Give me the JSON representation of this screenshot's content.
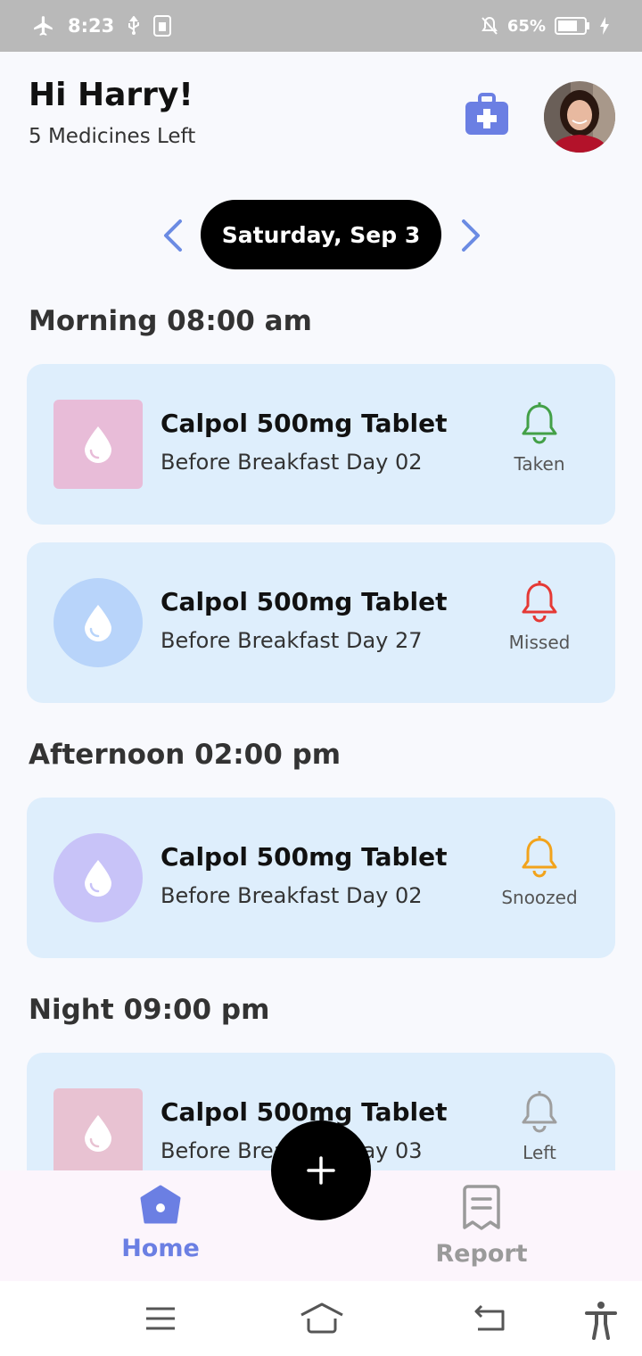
{
  "status_bar": {
    "time": "8:23",
    "battery": "65%",
    "icons": [
      "airplane-icon",
      "usb-icon",
      "sim-icon",
      "mute-icon",
      "battery-icon",
      "charging-icon"
    ]
  },
  "header": {
    "greeting": "Hi Harry!",
    "subtitle": "5 Medicines Left",
    "icons": [
      "medical-kit-icon",
      "avatar"
    ]
  },
  "date_picker": {
    "date": "Saturday, Sep 3"
  },
  "sections": [
    {
      "title": "Morning 08:00 am",
      "items": [
        {
          "name": "Calpol 500mg Tablet",
          "desc": "Before Breakfast Day 02",
          "status": "Taken",
          "status_color": "#43a047",
          "icon_bg": "#e8bcd8",
          "icon_shape": "square"
        },
        {
          "name": "Calpol 500mg Tablet",
          "desc": "Before Breakfast Day 27",
          "status": "Missed",
          "status_color": "#e53935",
          "icon_bg": "#b8d4fa",
          "icon_shape": "circle"
        }
      ]
    },
    {
      "title": "Afternoon 02:00 pm",
      "items": [
        {
          "name": "Calpol 500mg Tablet",
          "desc": "Before Breakfast Day 02",
          "status": "Snoozed",
          "status_color": "#f2a31b",
          "icon_bg": "#c8c3f8",
          "icon_shape": "circle"
        }
      ]
    },
    {
      "title": "Night 09:00 pm",
      "items": [
        {
          "name": "Calpol 500mg Tablet",
          "desc": "Before Breakfast Day 03",
          "status": "Left",
          "status_color": "#9e9e9e",
          "icon_bg": "#e8c2d2",
          "icon_shape": "square"
        }
      ]
    }
  ],
  "bottom_nav": {
    "home": "Home",
    "report": "Report",
    "active_color": "#6b7fe3",
    "inactive_color": "#9a9a9a"
  },
  "fab": {
    "icon": "plus-icon"
  },
  "system_nav": {
    "icons": [
      "menu-icon",
      "home-outline-icon",
      "back-icon",
      "accessibility-icon"
    ]
  }
}
